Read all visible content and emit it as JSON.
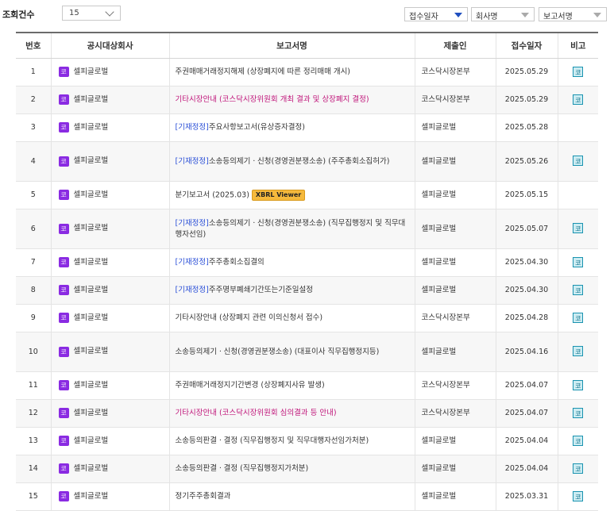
{
  "toolbar": {
    "count_label": "조회건수",
    "count_value": "15",
    "sort_options": [
      {
        "label": "접수일자",
        "active": true
      },
      {
        "label": "회사명",
        "active": false
      },
      {
        "label": "보고서명",
        "active": false
      }
    ]
  },
  "table": {
    "headers": [
      "번호",
      "공시대상회사",
      "보고서명",
      "제출인",
      "접수일자",
      "비고"
    ],
    "market_badge_text": "코",
    "note_badge_text": "코",
    "rows": [
      {
        "num": "1",
        "company": "셀피글로벌",
        "tag": "",
        "title": "주권매매거래정지해제 (상장폐지에 따른 정리매매 개시)",
        "pink": false,
        "xbrl": "",
        "submitter": "코스닥시장본부",
        "date": "2025.05.29",
        "note": true
      },
      {
        "num": "2",
        "company": "셀피글로벌",
        "tag": "",
        "title": "기타시장안내 (코스닥시장위원회 개최 결과 및 상장폐지 결정)",
        "pink": true,
        "xbrl": "",
        "submitter": "코스닥시장본부",
        "date": "2025.05.29",
        "note": true
      },
      {
        "num": "3",
        "company": "셀피글로벌",
        "tag": "[기재정정]",
        "title": "주요사항보고서(유상증자결정)",
        "pink": false,
        "xbrl": "",
        "submitter": "셀피글로벌",
        "date": "2025.05.28",
        "note": false
      },
      {
        "num": "4",
        "company": "셀피글로벌",
        "tag": "[기재정정]",
        "title": "소송등의제기ㆍ신청(경영권분쟁소송) (주주총회소집허가)",
        "pink": false,
        "xbrl": "",
        "submitter": "셀피글로벌",
        "date": "2025.05.26",
        "note": true
      },
      {
        "num": "5",
        "company": "셀피글로벌",
        "tag": "",
        "title": "분기보고서 (2025.03)",
        "pink": false,
        "xbrl": "XBRL Viewer",
        "submitter": "셀피글로벌",
        "date": "2025.05.15",
        "note": false
      },
      {
        "num": "6",
        "company": "셀피글로벌",
        "tag": "[기재정정]",
        "title": "소송등의제기ㆍ신청(경영권분쟁소송) (직무집행정지 및 직무대행자선임)",
        "pink": false,
        "xbrl": "",
        "submitter": "셀피글로벌",
        "date": "2025.05.07",
        "note": true
      },
      {
        "num": "7",
        "company": "셀피글로벌",
        "tag": "[기재정정]",
        "title": "주주총회소집결의",
        "pink": false,
        "xbrl": "",
        "submitter": "셀피글로벌",
        "date": "2025.04.30",
        "note": true
      },
      {
        "num": "8",
        "company": "셀피글로벌",
        "tag": "[기재정정]",
        "title": "주주명부폐쇄기간또는기준일설정",
        "pink": false,
        "xbrl": "",
        "submitter": "셀피글로벌",
        "date": "2025.04.30",
        "note": true
      },
      {
        "num": "9",
        "company": "셀피글로벌",
        "tag": "",
        "title": "기타시장안내 (상장폐지 관련 이의신청서 접수)",
        "pink": false,
        "xbrl": "",
        "submitter": "코스닥시장본부",
        "date": "2025.04.28",
        "note": true
      },
      {
        "num": "10",
        "company": "셀피글로벌",
        "tag": "",
        "title": "소송등의제기ㆍ신청(경영권분쟁소송) (대표이사 직무집행정지등)",
        "pink": false,
        "xbrl": "",
        "submitter": "셀피글로벌",
        "date": "2025.04.16",
        "note": true
      },
      {
        "num": "11",
        "company": "셀피글로벌",
        "tag": "",
        "title": "주권매매거래정지기간변경 (상장폐지사유 발생)",
        "pink": false,
        "xbrl": "",
        "submitter": "코스닥시장본부",
        "date": "2025.04.07",
        "note": true
      },
      {
        "num": "12",
        "company": "셀피글로벌",
        "tag": "",
        "title": "기타시장안내 (코스닥시장위원회 심의결과 등 안내)",
        "pink": true,
        "xbrl": "",
        "submitter": "코스닥시장본부",
        "date": "2025.04.07",
        "note": true
      },
      {
        "num": "13",
        "company": "셀피글로벌",
        "tag": "",
        "title": "소송등의판결ㆍ결정 (직무집행정지 및 직무대행자선임가처분)",
        "pink": false,
        "xbrl": "",
        "submitter": "셀피글로벌",
        "date": "2025.04.04",
        "note": true
      },
      {
        "num": "14",
        "company": "셀피글로벌",
        "tag": "",
        "title": "소송등의판결ㆍ결정 (직무집행정지가처분)",
        "pink": false,
        "xbrl": "",
        "submitter": "셀피글로벌",
        "date": "2025.04.04",
        "note": true
      },
      {
        "num": "15",
        "company": "셀피글로벌",
        "tag": "",
        "title": "정기주주총회결과",
        "pink": false,
        "xbrl": "",
        "submitter": "셀피글로벌",
        "date": "2025.03.31",
        "note": true
      }
    ]
  }
}
